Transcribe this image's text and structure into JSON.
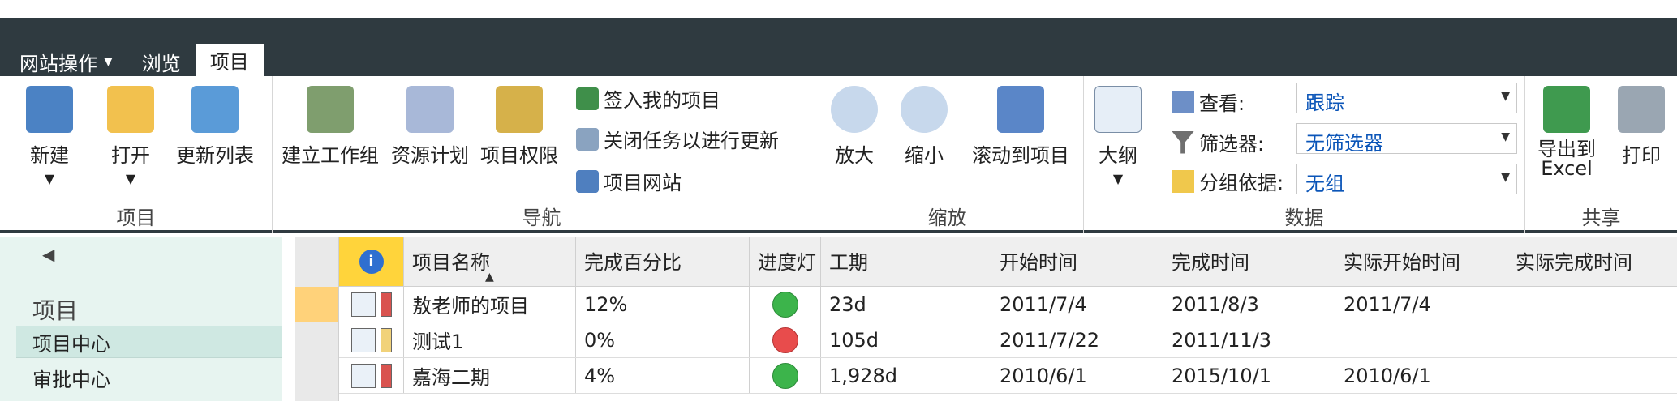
{
  "tabs": {
    "site_actions": "网站操作",
    "browse": "浏览",
    "project": "项目"
  },
  "ribbon": {
    "project_group": {
      "label": "项目",
      "new": "新建",
      "open": "打开",
      "update_list": "更新列表"
    },
    "nav_group": {
      "label": "导航",
      "build_team": "建立工作组",
      "resource_plan": "资源计划",
      "project_permissions": "项目权限",
      "check_in": "签入我的项目",
      "close_tasks": "关闭任务以进行更新",
      "project_site": "项目网站"
    },
    "zoom_group": {
      "label": "缩放",
      "zoom_in": "放大",
      "zoom_out": "缩小",
      "scroll_to": "滚动到项目"
    },
    "data_group": {
      "label": "数据",
      "outline": "大纲",
      "view_label": "查看:",
      "view_value": "跟踪",
      "filter_label": "筛选器:",
      "filter_value": "无筛选器",
      "group_label": "分组依据:",
      "group_value": "无组"
    },
    "share_group": {
      "label": "共享",
      "export_excel": "导出到\nExcel",
      "print": "打印"
    }
  },
  "sidebar": {
    "back": "◀",
    "title": "项目",
    "items": [
      {
        "label": "项目中心"
      },
      {
        "label": "审批中心"
      }
    ]
  },
  "table": {
    "headers": [
      "项目名称",
      "完成百分比",
      "进度灯",
      "工期",
      "开始时间",
      "完成时间",
      "实际开始时间",
      "实际完成时间"
    ],
    "rows": [
      {
        "name": "敖老师的项目",
        "percent": "12%",
        "status": "green",
        "duration": "23d",
        "start": "2011/7/4",
        "finish": "2011/8/3",
        "actual_start": "2011/7/4",
        "actual_finish": ""
      },
      {
        "name": "测试1",
        "percent": "0%",
        "status": "red",
        "duration": "105d",
        "start": "2011/7/22",
        "finish": "2011/11/3",
        "actual_start": "",
        "actual_finish": ""
      },
      {
        "name": "嘉海二期",
        "percent": "4%",
        "status": "green",
        "duration": "1,928d",
        "start": "2010/6/1",
        "finish": "2015/10/1",
        "actual_start": "2010/6/1",
        "actual_finish": ""
      }
    ]
  },
  "colors": {
    "topbar": "#2f3a40",
    "sidebar": "#e7f4f0",
    "status_green": "#3cb44b",
    "status_red": "#e84c4c",
    "select_text": "#0b55b8"
  }
}
